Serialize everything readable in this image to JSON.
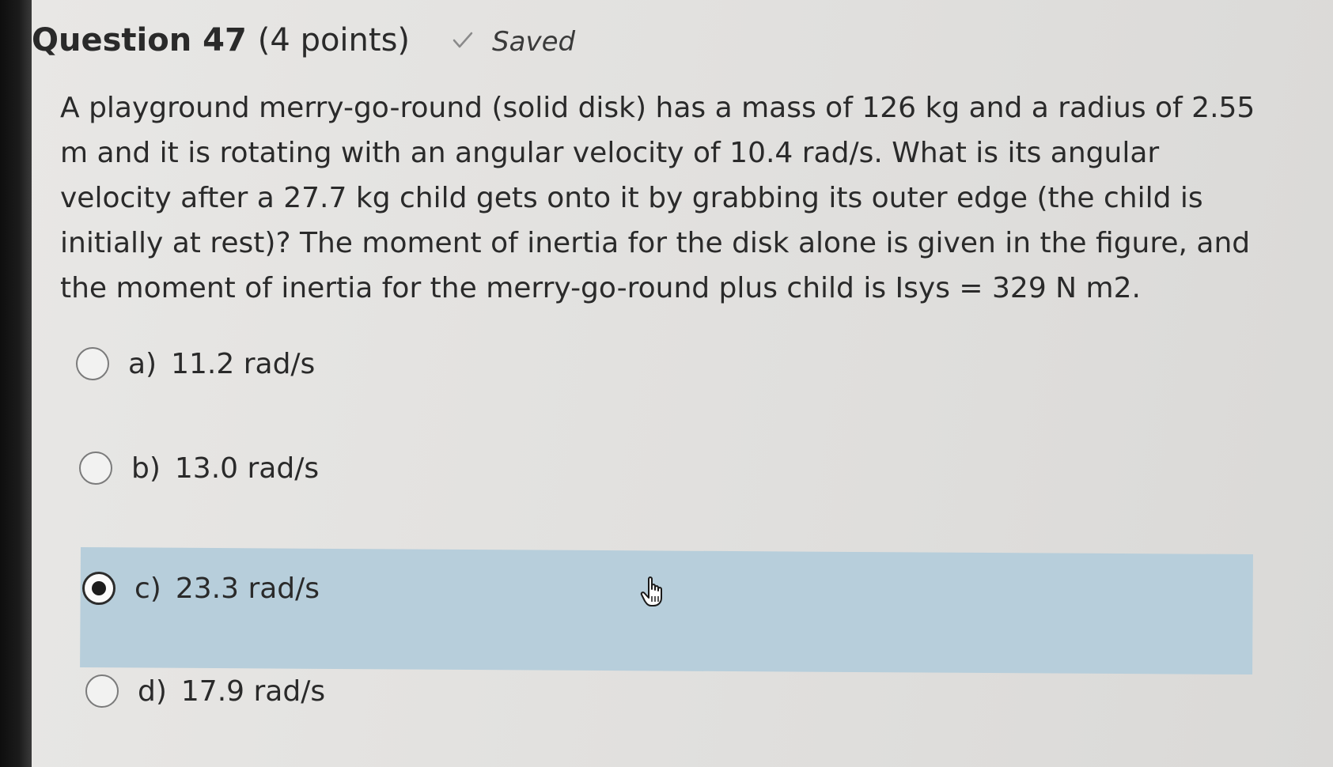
{
  "question": {
    "title": "Question 47",
    "points": "(4 points)",
    "status": "Saved",
    "text": "A playground merry-go-round (solid disk) has a mass of 126 kg and a radius of 2.55 m and it is rotating with an angular velocity of 10.4 rad/s. What is its angular velocity after a 27.7 kg child gets onto it by grabbing its outer edge (the child is initially at rest)? The moment of inertia for the disk alone is given in the figure, and the moment of inertia for the merry-go-round plus child is Isys = 329 N m2."
  },
  "options": [
    {
      "letter": "a)",
      "label": "11.2 rad/s",
      "selected": false
    },
    {
      "letter": "b)",
      "label": "13.0 rad/s",
      "selected": false
    },
    {
      "letter": "c)",
      "label": "23.3 rad/s",
      "selected": true
    },
    {
      "letter": "d)",
      "label": "17.9 rad/s",
      "selected": false
    }
  ],
  "colors": {
    "selected_highlight": "#b7cedb",
    "text": "#2a2a2a",
    "saved_check": "#8a8a8a"
  },
  "icons": {
    "status": "check-icon",
    "pointer": "hand-pointer-icon"
  }
}
